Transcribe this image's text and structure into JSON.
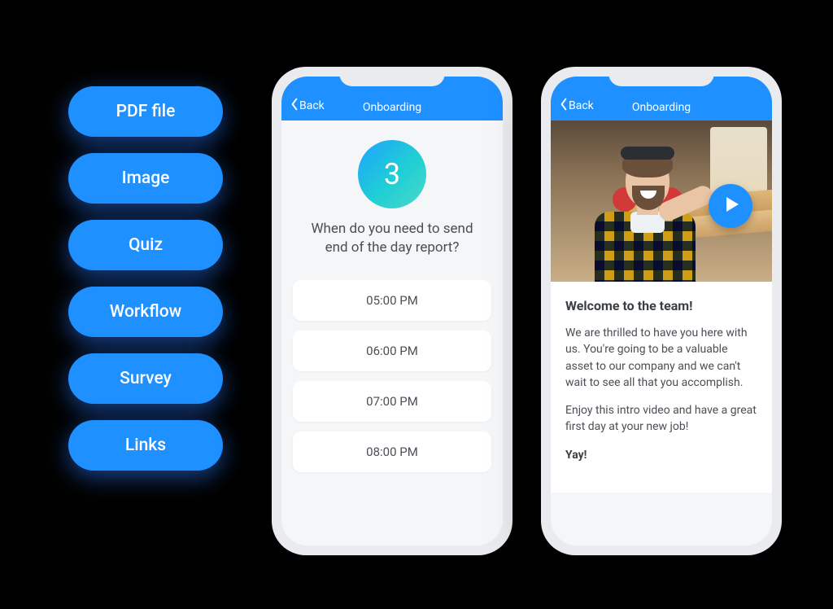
{
  "pills": {
    "items": [
      {
        "label": "PDF file"
      },
      {
        "label": "Image"
      },
      {
        "label": "Quiz"
      },
      {
        "label": "Workflow"
      },
      {
        "label": "Survey"
      },
      {
        "label": "Links"
      }
    ]
  },
  "colors": {
    "primary": "#1E90FF"
  },
  "phone1": {
    "back_label": "Back",
    "title": "Onboarding",
    "step_number": "3",
    "question": "When do you need to send end of the day report?",
    "options": [
      "05:00 PM",
      "06:00 PM",
      "07:00 PM",
      "08:00 PM"
    ]
  },
  "phone2": {
    "back_label": "Back",
    "title": "Onboarding",
    "heading": "Welcome to the team!",
    "para1": "We are thrilled to have you here with us. You're going to be a valuable asset to our company and we can't wait to see all that you accomplish.",
    "para2": "Enjoy this intro video and have a great first day at your new job!",
    "yay": "Yay!"
  }
}
